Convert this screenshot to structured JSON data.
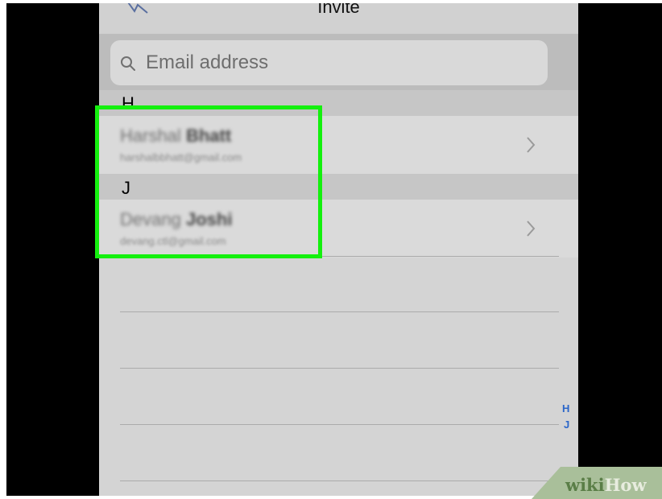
{
  "nav": {
    "title": "Invite",
    "back_icon": "back-arrow-icon"
  },
  "search": {
    "placeholder": "Email address",
    "icon": "search-icon"
  },
  "sections": [
    {
      "letter": "H",
      "contacts": [
        {
          "first_name": "Harshal",
          "last_name": "Bhatt",
          "email": "harshalbbhatt@gmail.com"
        }
      ]
    },
    {
      "letter": "J",
      "contacts": [
        {
          "first_name": "Devang",
          "last_name": "Joshi",
          "email": "devang.ctl@gmail.com"
        }
      ]
    }
  ],
  "index": [
    "H",
    "J"
  ],
  "colors": {
    "highlight": "#14f00e",
    "index_letters": "#2b66c9",
    "screen_bg": "#d4d4d4"
  },
  "watermark": {
    "wiki": "wiki",
    "how": "How"
  }
}
